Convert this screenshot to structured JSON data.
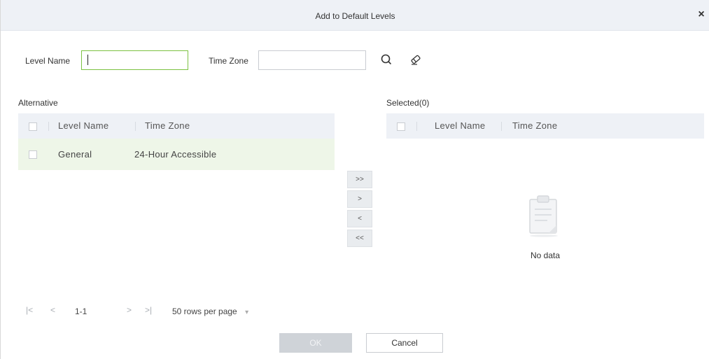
{
  "dialog": {
    "title": "Add to Default Levels",
    "close_glyph": "×"
  },
  "search": {
    "level_name_label": "Level Name",
    "level_name_value": "",
    "time_zone_label": "Time Zone",
    "time_zone_value": "",
    "search_icon": "search-icon",
    "clear_icon": "eraser-icon"
  },
  "alternative": {
    "title": "Alternative",
    "columns": [
      "Level Name",
      "Time Zone"
    ],
    "rows": [
      {
        "level_name": "General",
        "time_zone": "24-Hour Accessible"
      }
    ]
  },
  "selected": {
    "title": "Selected(0)",
    "columns": [
      "Level Name",
      "Time Zone"
    ],
    "empty_text": "No data"
  },
  "transfer_buttons": [
    ">>",
    ">",
    "<",
    "<<"
  ],
  "pagination": {
    "first": "|<",
    "prev": "<",
    "range": "1-1",
    "next": ">",
    "last": ">|",
    "rows_per_page": "50 rows per page",
    "dropdown_glyph": "▾"
  },
  "footer": {
    "ok_label": "OK",
    "cancel_label": "Cancel"
  },
  "colors": {
    "header_bg": "#eef1f6",
    "selected_row_bg": "#eef6e8",
    "focus_border": "#7cc242"
  }
}
